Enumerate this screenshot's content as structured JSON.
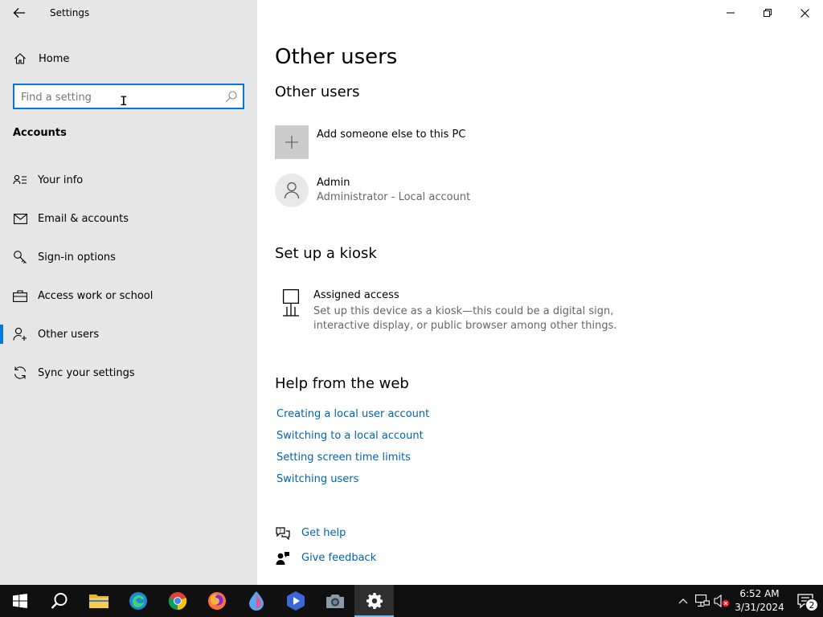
{
  "window": {
    "title": "Settings"
  },
  "sidebar": {
    "home_label": "Home",
    "search_placeholder": "Find a setting",
    "section": "Accounts",
    "items": [
      {
        "label": "Your info",
        "icon": "contact-card-icon"
      },
      {
        "label": "Email & accounts",
        "icon": "mail-icon"
      },
      {
        "label": "Sign-in options",
        "icon": "key-icon"
      },
      {
        "label": "Access work or school",
        "icon": "briefcase-icon"
      },
      {
        "label": "Other users",
        "icon": "person-add-icon",
        "active": true
      },
      {
        "label": "Sync your settings",
        "icon": "sync-icon"
      }
    ]
  },
  "main": {
    "page_title": "Other users",
    "other_users": {
      "heading": "Other users",
      "add_label": "Add someone else to this PC",
      "users": [
        {
          "name": "Admin",
          "sub": "Administrator - Local account"
        }
      ]
    },
    "kiosk": {
      "heading": "Set up a kiosk",
      "title": "Assigned access",
      "description": "Set up this device as a kiosk—this could be a digital sign, interactive display, or public browser among other things."
    },
    "help": {
      "heading": "Help from the web",
      "links": [
        "Creating a local user account",
        "Switching to a local account",
        "Setting screen time limits",
        "Switching users"
      ]
    },
    "get_help": "Get help",
    "give_feedback": "Give feedback"
  },
  "taskbar": {
    "time": "6:52 AM",
    "date": "3/31/2024",
    "notification_count": "2"
  },
  "colors": {
    "accent": "#0078d7",
    "link": "#0063b1",
    "sidebar_bg": "#e6e6e6",
    "taskbar_bg": "#101010"
  }
}
